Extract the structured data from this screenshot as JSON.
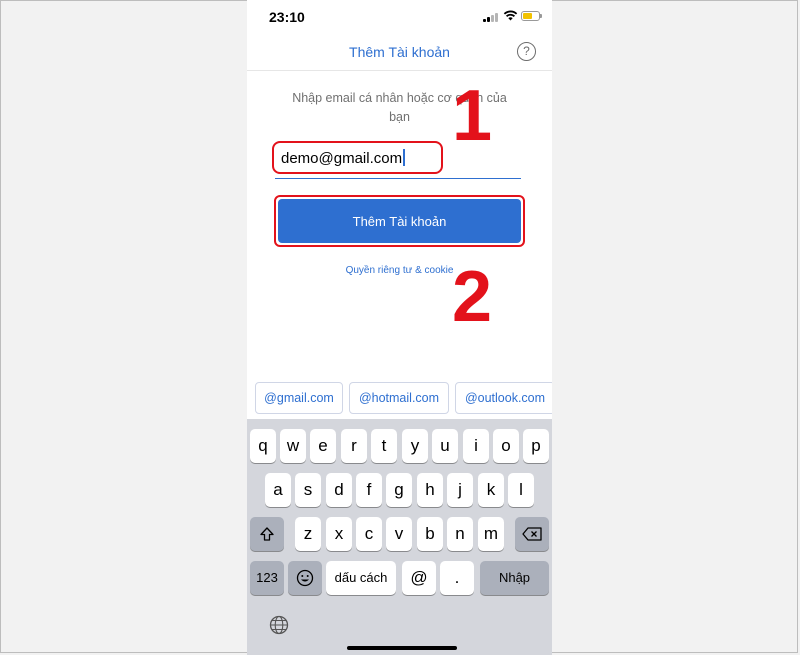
{
  "status": {
    "time": "23:10"
  },
  "header": {
    "title": "Thêm Tài khoản",
    "help": "?"
  },
  "prompt": {
    "line1": "Nhập email cá nhân hoặc cơ quan của",
    "line2": "bạn"
  },
  "email": {
    "value": "demo@gmail.com"
  },
  "add_button": {
    "label": "Thêm Tài khoản"
  },
  "privacy": {
    "label": "Quyền riêng tư & cookie"
  },
  "suggestions": [
    "@gmail.com",
    "@hotmail.com",
    "@outlook.com"
  ],
  "keyboard": {
    "row1": [
      "q",
      "w",
      "e",
      "r",
      "t",
      "y",
      "u",
      "i",
      "o",
      "p"
    ],
    "row2": [
      "a",
      "s",
      "d",
      "f",
      "g",
      "h",
      "j",
      "k",
      "l"
    ],
    "row3": [
      "z",
      "x",
      "c",
      "v",
      "b",
      "n",
      "m"
    ],
    "numbers": "123",
    "space": "dấu cách",
    "at": "@",
    "dot": ".",
    "return": "Nhập"
  },
  "annotations": {
    "step1": "1",
    "step2": "2"
  },
  "colors": {
    "accent": "#2e6fd0",
    "highlight": "#e3121b"
  }
}
